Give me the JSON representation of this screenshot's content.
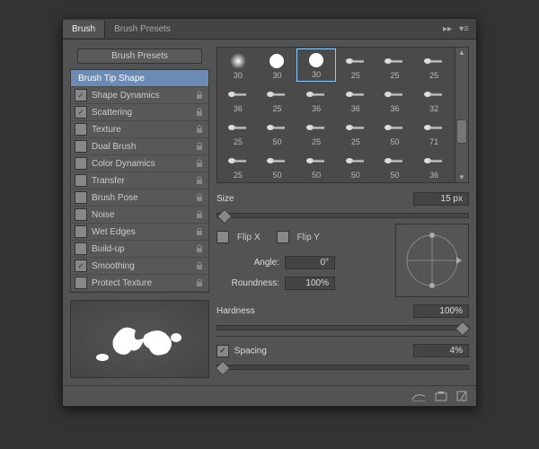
{
  "tabs": {
    "brush": "Brush",
    "presets": "Brush Presets"
  },
  "presets_button": "Brush Presets",
  "options": [
    {
      "label": "Brush Tip Shape",
      "checked": null,
      "lock": false,
      "selected": true
    },
    {
      "label": "Shape Dynamics",
      "checked": true,
      "lock": true
    },
    {
      "label": "Scattering",
      "checked": true,
      "lock": true
    },
    {
      "label": "Texture",
      "checked": false,
      "lock": true
    },
    {
      "label": "Dual Brush",
      "checked": false,
      "lock": true
    },
    {
      "label": "Color Dynamics",
      "checked": false,
      "lock": true
    },
    {
      "label": "Transfer",
      "checked": false,
      "lock": true
    },
    {
      "label": "Brush Pose",
      "checked": false,
      "lock": true
    },
    {
      "label": "Noise",
      "checked": false,
      "lock": true
    },
    {
      "label": "Wet Edges",
      "checked": false,
      "lock": true
    },
    {
      "label": "Build-up",
      "checked": false,
      "lock": true
    },
    {
      "label": "Smoothing",
      "checked": true,
      "lock": true
    },
    {
      "label": "Protect Texture",
      "checked": false,
      "lock": true
    }
  ],
  "thumbnails": [
    {
      "size": "30",
      "type": "soft",
      "selected": false
    },
    {
      "size": "30",
      "type": "hard",
      "selected": false
    },
    {
      "size": "30",
      "type": "hard",
      "selected": true
    },
    {
      "size": "25",
      "type": "stroke"
    },
    {
      "size": "25",
      "type": "stroke"
    },
    {
      "size": "25",
      "type": "stroke"
    },
    {
      "size": "36",
      "type": "stroke"
    },
    {
      "size": "25",
      "type": "stroke"
    },
    {
      "size": "36",
      "type": "stroke"
    },
    {
      "size": "36",
      "type": "stroke"
    },
    {
      "size": "36",
      "type": "stroke"
    },
    {
      "size": "32",
      "type": "stroke"
    },
    {
      "size": "25",
      "type": "stroke"
    },
    {
      "size": "50",
      "type": "stroke"
    },
    {
      "size": "25",
      "type": "stroke"
    },
    {
      "size": "25",
      "type": "stroke"
    },
    {
      "size": "50",
      "type": "stroke"
    },
    {
      "size": "71",
      "type": "stroke"
    },
    {
      "size": "25",
      "type": "stroke"
    },
    {
      "size": "50",
      "type": "stroke"
    },
    {
      "size": "50",
      "type": "stroke"
    },
    {
      "size": "50",
      "type": "stroke"
    },
    {
      "size": "50",
      "type": "stroke"
    },
    {
      "size": "36",
      "type": "stroke"
    }
  ],
  "size": {
    "label": "Size",
    "value": "15 px"
  },
  "flipx": {
    "label": "Flip X",
    "checked": false
  },
  "flipy": {
    "label": "Flip Y",
    "checked": false
  },
  "angle": {
    "label": "Angle:",
    "value": "0°"
  },
  "roundness": {
    "label": "Roundness:",
    "value": "100%"
  },
  "hardness": {
    "label": "Hardness",
    "value": "100%"
  },
  "spacing": {
    "label": "Spacing",
    "value": "4%",
    "checked": true
  }
}
